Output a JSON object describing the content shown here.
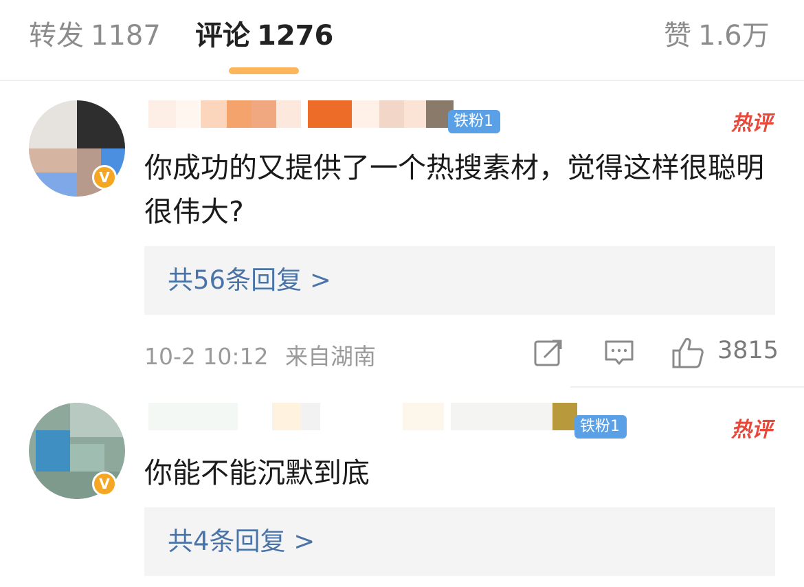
{
  "tabs": {
    "repost_label": "转发",
    "repost_count": "1187",
    "comment_label": "评论",
    "comment_count": "1276",
    "like_label": "赞",
    "like_count": "1.6万"
  },
  "comments": [
    {
      "fan_badge": "铁粉1",
      "hot_label": "热评",
      "text": "你成功的又提供了一个热搜素材，觉得这样很聪明很伟大?",
      "replies_label": "共56条回复 >",
      "time": "10-2 10:12",
      "location": "来自湖南",
      "likes": "3815"
    },
    {
      "fan_badge": "铁粉1",
      "hot_label": "热评",
      "text": "你能不能沉默到底",
      "replies_label": "共4条回复 >"
    }
  ],
  "colors": {
    "accent_underline": "#fbb55a",
    "fan_badge_bg": "#5aa0e6",
    "hot_tag": "#e8483a",
    "reply_link": "#4a74a8"
  },
  "icons": [
    "verified-badge-icon",
    "repost-icon",
    "comment-icon",
    "like-icon"
  ]
}
